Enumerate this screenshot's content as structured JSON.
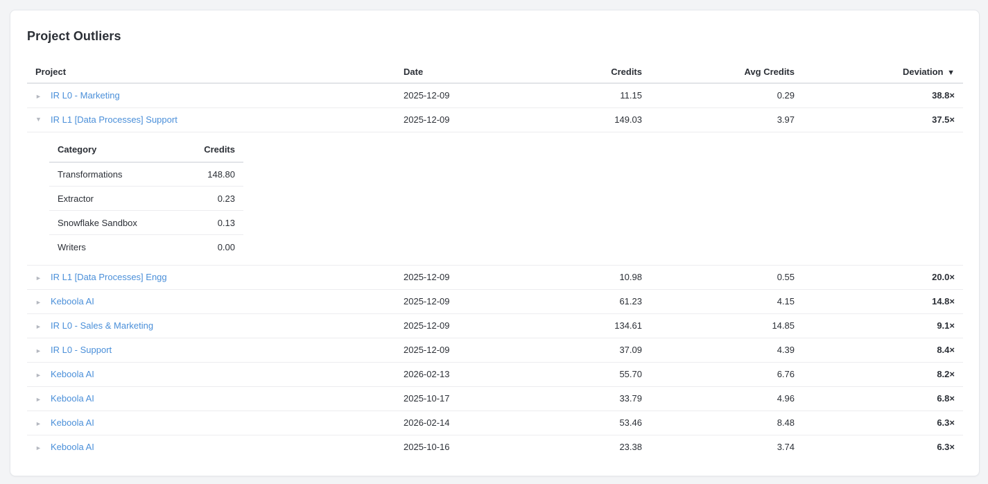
{
  "title": "Project Outliers",
  "columns": {
    "project": "Project",
    "date": "Date",
    "credits": "Credits",
    "avg_credits": "Avg Credits",
    "deviation": "Deviation",
    "sort_indicator": "▼"
  },
  "icons": {
    "collapsed": "►",
    "expanded": "▼"
  },
  "rows": [
    {
      "project": "IR L0 - Marketing",
      "date": "2025-12-09",
      "credits": "11.15",
      "avg": "0.29",
      "deviation": "38.8×"
    },
    {
      "project": "IR L1 [Data Processes] Support",
      "date": "2025-12-09",
      "credits": "149.03",
      "avg": "3.97",
      "deviation": "37.5×"
    },
    {
      "project": "IR L1 [Data Processes] Engg",
      "date": "2025-12-09",
      "credits": "10.98",
      "avg": "0.55",
      "deviation": "20.0×"
    },
    {
      "project": "Keboola AI",
      "date": "2025-12-09",
      "credits": "61.23",
      "avg": "4.15",
      "deviation": "14.8×"
    },
    {
      "project": "IR L0 - Sales & Marketing",
      "date": "2025-12-09",
      "credits": "134.61",
      "avg": "14.85",
      "deviation": "9.1×"
    },
    {
      "project": "IR L0 - Support",
      "date": "2025-12-09",
      "credits": "37.09",
      "avg": "4.39",
      "deviation": "8.4×"
    },
    {
      "project": "Keboola AI",
      "date": "2026-02-13",
      "credits": "55.70",
      "avg": "6.76",
      "deviation": "8.2×"
    },
    {
      "project": "Keboola AI",
      "date": "2025-10-17",
      "credits": "33.79",
      "avg": "4.96",
      "deviation": "6.8×"
    },
    {
      "project": "Keboola AI",
      "date": "2026-02-14",
      "credits": "53.46",
      "avg": "8.48",
      "deviation": "6.3×"
    },
    {
      "project": "Keboola AI",
      "date": "2025-10-16",
      "credits": "23.38",
      "avg": "3.74",
      "deviation": "6.3×"
    }
  ],
  "detail": {
    "category_header": "Category",
    "credits_header": "Credits",
    "items": [
      {
        "category": "Transformations",
        "credits": "148.80"
      },
      {
        "category": "Extractor",
        "credits": "0.23"
      },
      {
        "category": "Snowflake Sandbox",
        "credits": "0.13"
      },
      {
        "category": "Writers",
        "credits": "0.00"
      }
    ]
  }
}
